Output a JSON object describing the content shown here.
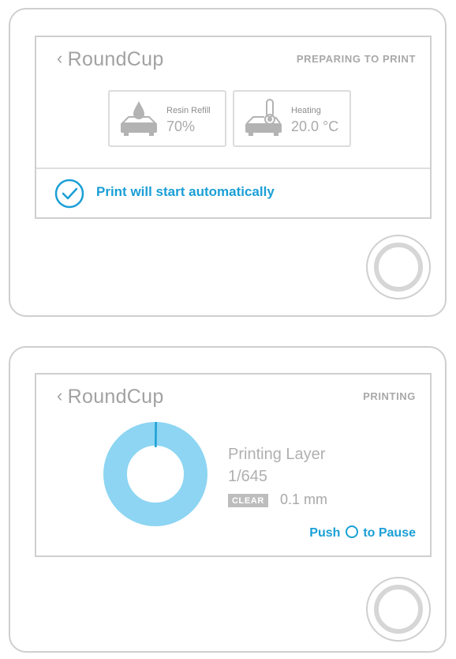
{
  "colors": {
    "accent": "#1a9fd6",
    "donut": "#8dd5f2",
    "border": "#cfcfcf",
    "text_gray": "#a2a2a2"
  },
  "panel1": {
    "back_icon": "chevron-left-icon",
    "title": "RoundCup",
    "status": "PREPARING TO PRINT",
    "resin": {
      "icon": "resin-drop-icon",
      "label": "Resin Refill",
      "value": "70%"
    },
    "heating": {
      "icon": "thermometer-icon",
      "label": "Heating",
      "value": "20.0 °C"
    },
    "auto_icon": "check-circle-icon",
    "auto_start": "Print will start automatically"
  },
  "panel2": {
    "back_icon": "chevron-left-icon",
    "title": "RoundCup",
    "status": "PRINTING",
    "progress": {
      "current": 1,
      "total": 645
    },
    "layer_label": "Printing Layer",
    "layer_value": "1/645",
    "material": "CLEAR",
    "thickness": "0.1 mm",
    "pause_prefix": "Push",
    "pause_suffix": "to Pause"
  }
}
